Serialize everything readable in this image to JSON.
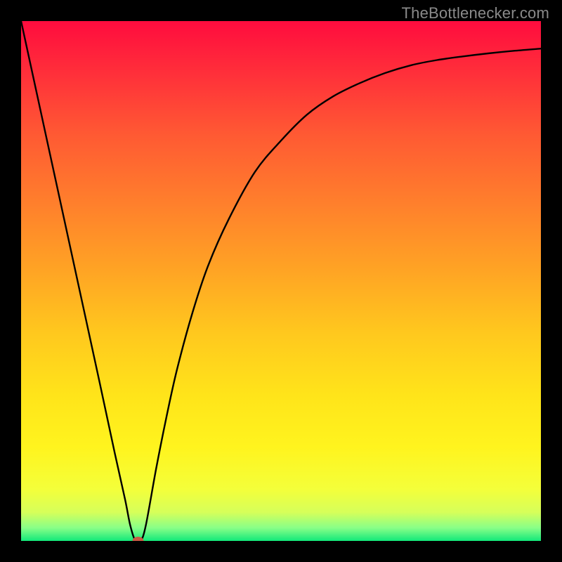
{
  "watermark": "TheBottlenecker.com",
  "chart_data": {
    "type": "line",
    "title": "",
    "xlabel": "",
    "ylabel": "",
    "xlim": [
      0,
      100
    ],
    "ylim": [
      0,
      100
    ],
    "series": [
      {
        "name": "bottleneck-curve",
        "x": [
          0,
          5,
          10,
          15,
          18,
          20,
          21,
          22,
          23,
          24,
          26,
          28,
          30,
          33,
          36,
          40,
          45,
          50,
          55,
          60,
          65,
          70,
          75,
          80,
          85,
          90,
          95,
          100
        ],
        "y": [
          100,
          77,
          54,
          31,
          17,
          8,
          3,
          0,
          0,
          3,
          14,
          24,
          33,
          44,
          53,
          62,
          71,
          77,
          82,
          85.5,
          88,
          90,
          91.5,
          92.5,
          93.2,
          93.8,
          94.3,
          94.7
        ]
      }
    ],
    "marker": {
      "x": 22.5,
      "y": 0,
      "color": "#cc5a44"
    },
    "gradient_stops": [
      {
        "offset": 0.0,
        "color": "#ff0c3e"
      },
      {
        "offset": 0.1,
        "color": "#ff2f3a"
      },
      {
        "offset": 0.22,
        "color": "#ff5a33"
      },
      {
        "offset": 0.35,
        "color": "#ff7f2c"
      },
      {
        "offset": 0.48,
        "color": "#ffa424"
      },
      {
        "offset": 0.6,
        "color": "#ffc81e"
      },
      {
        "offset": 0.72,
        "color": "#ffe41a"
      },
      {
        "offset": 0.82,
        "color": "#fff41e"
      },
      {
        "offset": 0.9,
        "color": "#f4ff3a"
      },
      {
        "offset": 0.945,
        "color": "#d6ff5a"
      },
      {
        "offset": 0.975,
        "color": "#88ff88"
      },
      {
        "offset": 1.0,
        "color": "#12e87a"
      }
    ]
  }
}
